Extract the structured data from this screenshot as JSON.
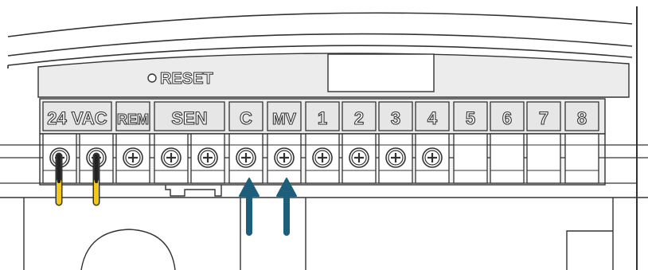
{
  "diagram": {
    "reset_label": "RESET",
    "terminal_labels": [
      "24 VAC",
      "REM",
      "SEN",
      "C",
      "MV",
      "1",
      "2",
      "3",
      "4",
      "5",
      "6",
      "7",
      "8"
    ],
    "arrow_targets": [
      "C",
      "MV"
    ],
    "colors": {
      "outline": "#333333",
      "panel_fill": "#ececec",
      "label_fill": "#e6e6e6",
      "wire": "#f2c81c",
      "arrow": "#1d5f7a"
    }
  }
}
